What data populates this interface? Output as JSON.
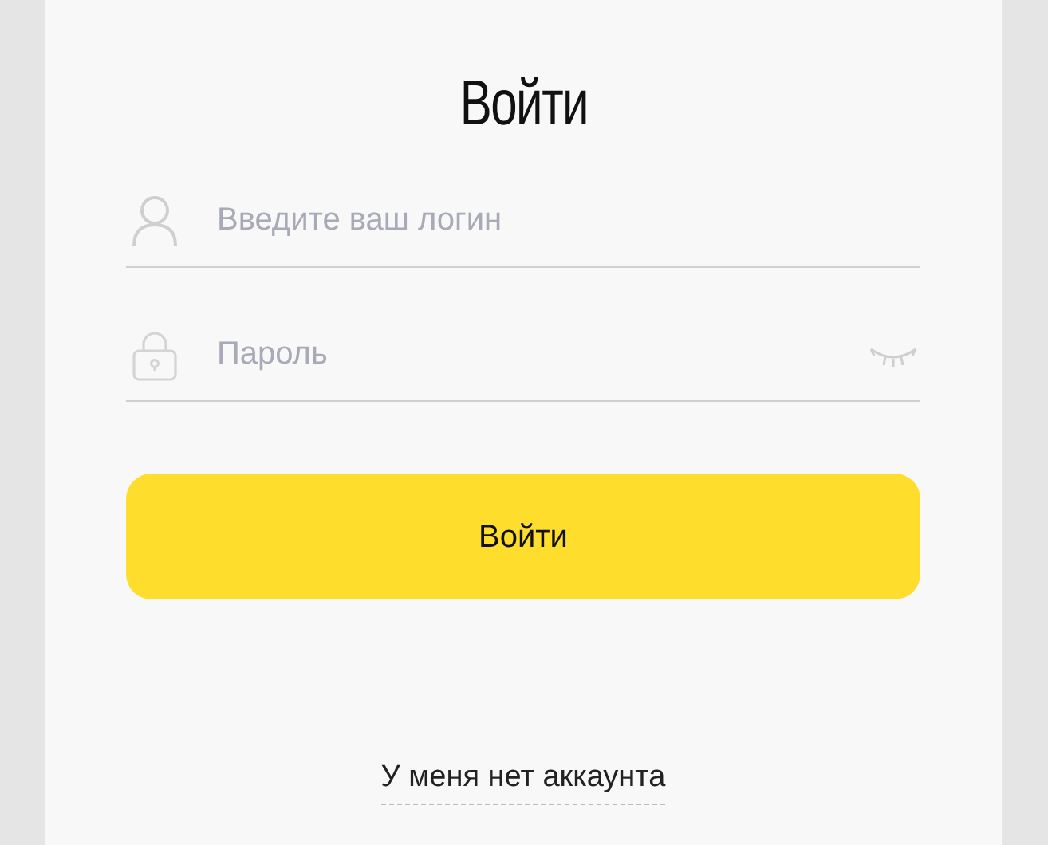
{
  "title": "Войти",
  "fields": [
    {
      "kind": "login",
      "placeholder": "Введите ваш логин"
    },
    {
      "kind": "password",
      "placeholder": "Пароль"
    }
  ],
  "submit_button": "Войти",
  "register_link": "У меня нет аккаунта"
}
